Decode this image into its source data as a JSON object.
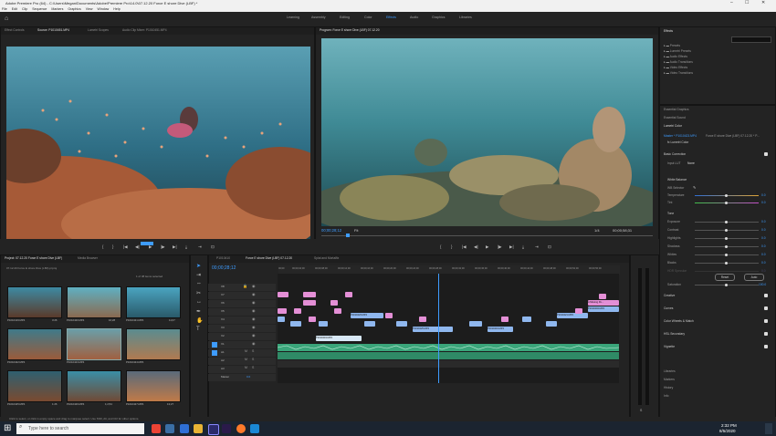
{
  "titlebar": {
    "title": "Adobe Premiere Pro (64) - C:\\Users\\Megan\\Documents\\Adobe\\Premiere Pro\\14.0\\07.12.20 Force E shore Dive (LBF) *"
  },
  "menubar": [
    "File",
    "Edit",
    "Clip",
    "Sequence",
    "Markers",
    "Graphics",
    "View",
    "Window",
    "Help"
  ],
  "workspaces": [
    "Learning",
    "Assembly",
    "Editing",
    "Color",
    "Effects",
    "Audio",
    "Graphics",
    "Libraries"
  ],
  "active_workspace": "Effects",
  "source_panel": {
    "tabs": [
      "Effect Controls",
      "Source: P1010451.MP4",
      "Lumetri Scopes",
      "Audio Clip Mixer: P1010451.MP4"
    ],
    "timecode_in": "00;48;05;15",
    "fit": "Fit",
    "zoom_ratio": "1/2",
    "timecode_out": "00;00;02;40"
  },
  "program_panel": {
    "tabs": [
      "Program: Force E shore Dive (LBF) 07.12.20"
    ],
    "timecode_in": "00;00;28;12",
    "fit": "Fit",
    "zoom_ratio": "1/4",
    "timecode_out": "00;00;58;31"
  },
  "transport": {
    "source_controls": [
      "▼",
      "{",
      "}",
      "|◀",
      "◀|",
      "▶",
      "|▶",
      "▶|",
      "⤓",
      "⇥",
      "⌂",
      "⊡"
    ],
    "program_controls": [
      "▼",
      "{",
      "}",
      "|◀",
      "◀|",
      "▶",
      "|▶",
      "▶|",
      "⤓",
      "⇥",
      "⌂",
      "⊡"
    ]
  },
  "project_panel": {
    "tabs": [
      "Project: 07.12.20 Force E shore Dive (LBF)",
      "Media Browser"
    ],
    "path": "07.12.20 Force E shore Dive (LBF).prproj",
    "selection": "1 of 38 items selected",
    "items": [
      {
        "name": "P1010419.MP4",
        "dur": "3:26"
      },
      {
        "name": "P1010420.MP4",
        "dur": "16;28"
      },
      {
        "name": "P1010421.MP4",
        "dur": "11;07"
      },
      {
        "name": "P1010422.MP4",
        "dur": ""
      },
      {
        "name": "P1010423.MP4",
        "dur": ""
      },
      {
        "name": "P1010424.MP4",
        "dur": ""
      },
      {
        "name": "P1010425.MP4",
        "dur": "1:26"
      },
      {
        "name": "P1010426.MP4",
        "dur": "1;2;54"
      },
      {
        "name": "P1010427.MP4",
        "dur": "13;27"
      }
    ]
  },
  "timeline": {
    "tabs": [
      "P1010410",
      "Force E shore Dive (LBF) 07.12.20",
      "Splat and Mortalfix"
    ],
    "timecode": "00;00;28;12",
    "ruler": [
      "00;00",
      "00;00;04;00",
      "00;00;08;00",
      "00;00;12;00",
      "00;00;16;00",
      "00;00;20;00",
      "00;00;24;00",
      "00;00;28;00",
      "00;00;32;00",
      "00;00;36;00",
      "00;00;40;00",
      "00;00;44;00",
      "00;00;48;00",
      "00;00;52;00",
      "00;00;56;00"
    ],
    "video_tracks": [
      "V8",
      "V7",
      "V6",
      "V5",
      "V4",
      "V3",
      "V2",
      "V1"
    ],
    "audio_tracks": [
      "A1",
      "A2",
      "A3"
    ],
    "master_label": "Master",
    "master_value": "0.0",
    "clip_labels": {
      "a": "P1010423.MP4",
      "b": "P1010425.MP4",
      "c": "P1010419.MP4",
      "d": "P1010421.MP4",
      "e": "Polar",
      "f": "P1010419.MP4",
      "g": "P1010429.MP4",
      "h": "P1010431.MP4",
      "i": "P1010435.MP4",
      "j": "A Missing Pe...",
      "k": "P1010404.MP4"
    }
  },
  "effects_panel": {
    "title": "Effects",
    "items": [
      "Presets",
      "Lumetri Presets",
      "Audio Effects",
      "Audio Transitions",
      "Video Effects",
      "Video Transitions"
    ]
  },
  "lumetri": {
    "tabs": [
      "Essential Graphics",
      "Essential Sound",
      "Lumetri Color"
    ],
    "clip": "Master * P1010423.MP4",
    "seq": "Force E shore Dive (LBF) 07.12.20 * P...",
    "fx": "fx Lumetri Color",
    "section_basic": "Basic Correction",
    "input_lut_label": "Input LUT",
    "input_lut_value": "None",
    "white_balance": "White Balance",
    "wb_selector": "WB Selector",
    "sliders_wb": [
      {
        "label": "Temperature",
        "value": "0.0"
      },
      {
        "label": "Tint",
        "value": "0.0"
      }
    ],
    "tone": "Tone",
    "sliders_tone": [
      {
        "label": "Exposure",
        "value": "0.0"
      },
      {
        "label": "Contrast",
        "value": "0.0"
      },
      {
        "label": "Highlights",
        "value": "0.0"
      },
      {
        "label": "Shadows",
        "value": "0.0"
      },
      {
        "label": "Whites",
        "value": "0.0"
      },
      {
        "label": "Blacks",
        "value": "0.0"
      },
      {
        "label": "HDR Specular",
        "value": "0.0"
      }
    ],
    "reset": "Reset",
    "auto": "Auto",
    "saturation_label": "Saturation",
    "saturation_value": "100.0",
    "sections": [
      "Creative",
      "Curves",
      "Color Wheels & Match",
      "HSL Secondary",
      "Vignette"
    ],
    "bottom_tabs": [
      "Libraries",
      "Markers",
      "History",
      "Info"
    ]
  },
  "status_bar": "Click to select, or click in empty space and drag to marquee select. Use Shift, Alt, and Ctrl for other options.",
  "taskbar": {
    "search_placeholder": "Type here to search",
    "time": "2:32 PM",
    "date": "8/5/2020"
  },
  "colors": {
    "accent": "#3e9cff",
    "video_clip_pink": "#e48fd6",
    "video_clip_blue": "#8fb7ee",
    "audio_clip_green": "#3aa57a"
  }
}
